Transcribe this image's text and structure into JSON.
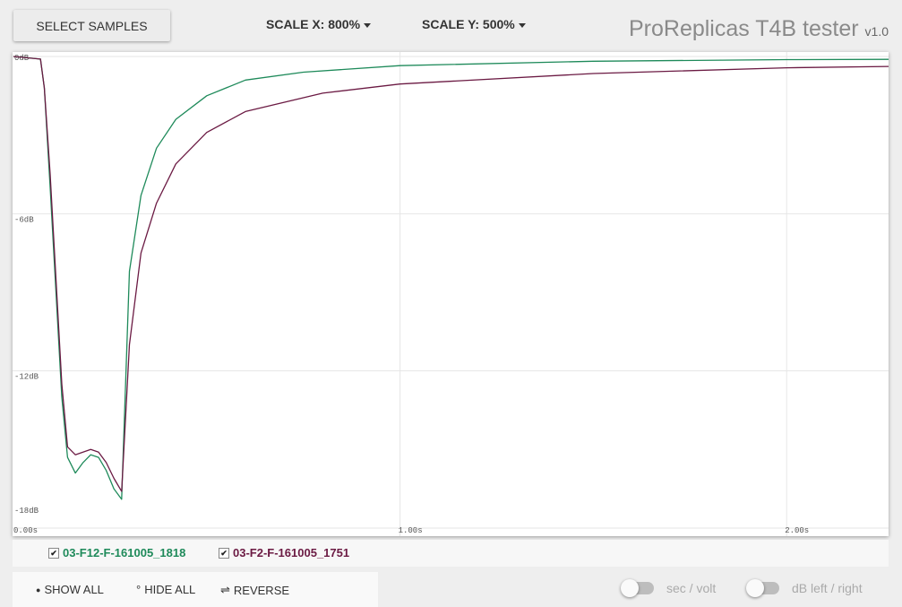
{
  "header": {
    "select_samples": "SELECT SAMPLES",
    "scale_x": "SCALE X: 800%",
    "scale_y": "SCALE Y: 500%",
    "title": "ProReplicas T4B tester",
    "version": "v1.0"
  },
  "chart_data": {
    "type": "line",
    "xlabel": "",
    "ylabel": "",
    "xlim": [
      0,
      2.27
    ],
    "ylim": [
      -18,
      0
    ],
    "grid": true,
    "x_ticks": [
      "0.00s",
      "1.00s",
      "2.00s"
    ],
    "y_ticks": [
      "0dB",
      "-6dB",
      "-12dB",
      "-18dB"
    ],
    "series": [
      {
        "name": "03-F12-F-161005_1818",
        "color": "#1e8a5a",
        "points": [
          [
            0,
            0
          ],
          [
            0.07,
            -0.1
          ],
          [
            0.08,
            -1.2
          ],
          [
            0.095,
            -5
          ],
          [
            0.11,
            -9
          ],
          [
            0.125,
            -13
          ],
          [
            0.14,
            -15.3
          ],
          [
            0.16,
            -15.9
          ],
          [
            0.18,
            -15.5
          ],
          [
            0.2,
            -15.2
          ],
          [
            0.22,
            -15.3
          ],
          [
            0.24,
            -15.8
          ],
          [
            0.26,
            -16.5
          ],
          [
            0.28,
            -16.9
          ],
          [
            0.3,
            -8.2
          ],
          [
            0.33,
            -5.3
          ],
          [
            0.37,
            -3.5
          ],
          [
            0.42,
            -2.4
          ],
          [
            0.5,
            -1.5
          ],
          [
            0.6,
            -0.9
          ],
          [
            0.75,
            -0.6
          ],
          [
            1.0,
            -0.35
          ],
          [
            1.5,
            -0.18
          ],
          [
            2.0,
            -0.12
          ],
          [
            2.27,
            -0.11
          ]
        ]
      },
      {
        "name": "03-F2-F-161005_1751",
        "color": "#6b1a43",
        "points": [
          [
            0,
            0
          ],
          [
            0.07,
            -0.1
          ],
          [
            0.08,
            -1.2
          ],
          [
            0.095,
            -4.5
          ],
          [
            0.11,
            -8.5
          ],
          [
            0.125,
            -12.5
          ],
          [
            0.14,
            -14.9
          ],
          [
            0.16,
            -15.2
          ],
          [
            0.18,
            -15.1
          ],
          [
            0.2,
            -15.0
          ],
          [
            0.22,
            -15.1
          ],
          [
            0.24,
            -15.5
          ],
          [
            0.26,
            -16.1
          ],
          [
            0.28,
            -16.6
          ],
          [
            0.3,
            -11
          ],
          [
            0.33,
            -7.5
          ],
          [
            0.37,
            -5.6
          ],
          [
            0.42,
            -4.1
          ],
          [
            0.5,
            -2.9
          ],
          [
            0.6,
            -2.1
          ],
          [
            0.8,
            -1.4
          ],
          [
            1.0,
            -1.05
          ],
          [
            1.5,
            -0.65
          ],
          [
            2.0,
            -0.43
          ],
          [
            2.27,
            -0.38
          ]
        ]
      }
    ]
  },
  "legend": [
    {
      "label": "03-F12-F-161005_1818",
      "checked": "✔",
      "color": "#1e8a5a"
    },
    {
      "label": "03-F2-F-161005_1751",
      "checked": "✔",
      "color": "#6b1a43"
    }
  ],
  "controls": {
    "show_all_icon": "●",
    "show_all": "SHOW ALL",
    "hide_all_icon": "°",
    "hide_all": "HIDE ALL",
    "reverse_icon": "⇌",
    "reverse": "REVERSE",
    "toggle_sec_volt": "sec / volt",
    "toggle_db_lr": "dB left / right"
  }
}
